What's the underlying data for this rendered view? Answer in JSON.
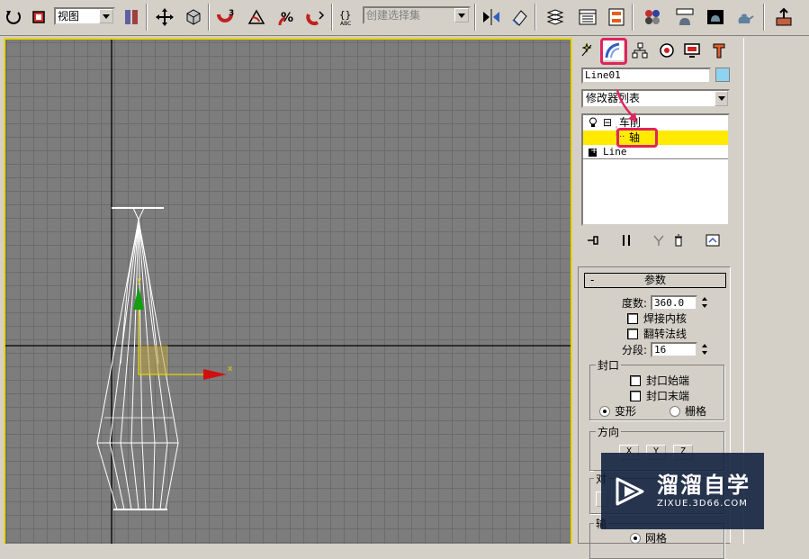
{
  "toolbar": {
    "view_dropdown": "视图",
    "selection_set_placeholder": "创建选择集",
    "snap_angle_label": "3",
    "icons": [
      "undo-icon",
      "select-region-icon",
      "view-coord-icon",
      "select-scale-icon",
      "move-icon",
      "rotate-icon",
      "angle-snap-icon",
      "spinner-snap-icon",
      "percent-snap-icon",
      "edit-named-sel-icon",
      "mirror-icon",
      "align-icon",
      "layer-manager-icon",
      "curve-editor-icon",
      "schematic-view-icon",
      "material-editor-icon",
      "render-scene-icon",
      "quick-render-icon",
      "render-type-icon",
      "teapot-icon",
      "render-frame-icon"
    ]
  },
  "command_panel": {
    "tabs": [
      "create-tab",
      "modify-tab",
      "hierarchy-tab",
      "motion-tab",
      "display-tab",
      "utilities-tab"
    ],
    "object_name": "Line01",
    "object_color": "#8ed3f0",
    "modifier_list": "修改器列表",
    "stack": {
      "lathe": "车削",
      "axis": "轴",
      "line": "Line"
    }
  },
  "parameters": {
    "title": "参数",
    "collapse": "-",
    "degrees_label": "度数:",
    "degrees_value": "360.0",
    "weld_core": "焊接内核",
    "flip_normals": "翻转法线",
    "segments_label": "分段:",
    "segments_value": "16",
    "capping_title": "封口",
    "cap_start": "封口始端",
    "cap_end": "封口末端",
    "morph": "变形",
    "grid": "栅格",
    "direction_title": "方向",
    "dir_x": "X",
    "dir_y": "Y",
    "dir_z": "Z",
    "align_title": "对",
    "output_title": "输",
    "output_grid": "网格"
  },
  "viewport": {
    "axis_x_label": "x",
    "axis_y_label": "y",
    "border_color": "#e6d500"
  },
  "watermark": {
    "title": "溜溜自学",
    "subtitle": "ZIXUE.3D66.COM"
  }
}
